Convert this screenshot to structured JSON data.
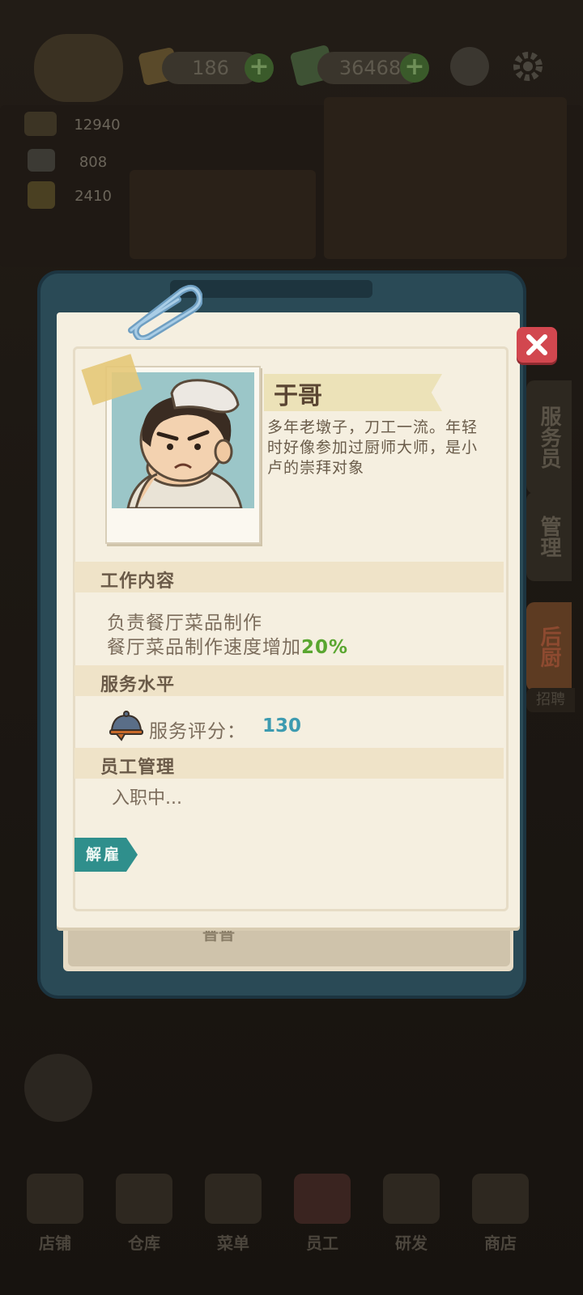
{
  "topbar": {
    "currency1_value": "186",
    "currency2_value": "36468",
    "plus_glyph": "+"
  },
  "left_stats": [
    "12940",
    "808",
    "2410"
  ],
  "side_tabs": [
    "服务员",
    "管理",
    "后厨"
  ],
  "side_tab_partial": "招聘",
  "bottom_nav": [
    "店铺",
    "仓库",
    "菜单",
    "员工",
    "研发",
    "商店"
  ],
  "dialog": {
    "name": "于哥",
    "bio": "多年老墩子，刀工一流。年轻时好像参加过厨师大师，是小卢的崇拜对象",
    "work_title": "工作内容",
    "work_line1": "负责餐厅菜品制作",
    "work_line2_prefix": "餐厅菜品制作速度增加",
    "work_line2_value": "20%",
    "service_title": "服务水平",
    "service_label": "服务评分：",
    "service_value": "130",
    "staff_title": "员工管理",
    "staff_status": "入职中...",
    "fire_button": "解雇",
    "close_glyph": "✕",
    "behind_text": "普普"
  },
  "icons": {
    "service": "cloche-icon",
    "close": "close-icon",
    "settings": "gear-icon",
    "camera": "camera-icon"
  },
  "colors": {
    "accent_green": "#5aa630",
    "service_value": "#3d9bb0",
    "fire_button": "#2f8f8c",
    "close_button": "#d2474f",
    "board": "#2a4a56"
  }
}
